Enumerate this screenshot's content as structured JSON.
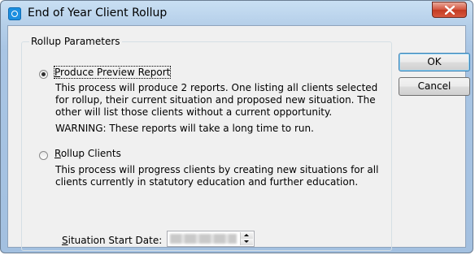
{
  "window": {
    "title": "End of Year Client Rollup",
    "close_icon": "close-icon"
  },
  "group": {
    "legend": "Rollup Parameters"
  },
  "options": [
    {
      "label_ul": "P",
      "label_rest": "roduce Preview Report",
      "selected": true,
      "description": "This process will produce 2 reports. One listing all clients selected\nfor rollup, their current situation and proposed new situation. The\nother will list those clients without a current opportunity.",
      "warning": "WARNING: These reports will take a long time to run."
    },
    {
      "label_ul": "R",
      "label_rest": "ollup Clients",
      "selected": false,
      "description": "This process will progress clients by creating new situations for all\nclients currently in statutory education and further education."
    }
  ],
  "date_field": {
    "label_ul": "S",
    "label_rest": "ituation Start Date:"
  },
  "buttons": {
    "ok": "OK",
    "cancel": "Cancel"
  },
  "colors": {
    "title_bar": "#b5cfe9",
    "close_button": "#c33b22",
    "dialog_background": "#f0f0f0"
  }
}
